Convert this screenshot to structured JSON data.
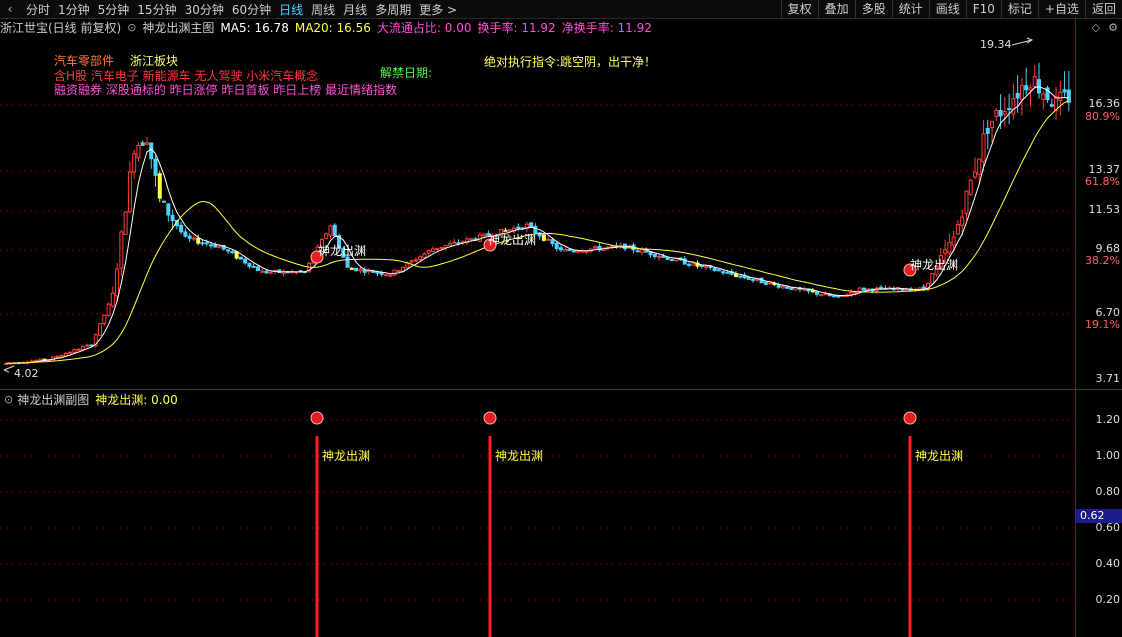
{
  "toolbar": {
    "periods": [
      "分时",
      "1分钟",
      "5分钟",
      "15分钟",
      "30分钟",
      "60分钟",
      "日线",
      "周线",
      "月线",
      "多周期",
      "更多 >"
    ],
    "active_period": "日线",
    "right_buttons": [
      "复权",
      "叠加",
      "多股",
      "统计",
      "画线",
      "F10",
      "标记",
      "+自选",
      "返回"
    ]
  },
  "info": {
    "stock": "浙江世宝(日线 前复权)",
    "indicator": "神龙出渊主图",
    "ma5": "MA5: 16.78",
    "ma20": "MA20: 16.56",
    "flow": "大流通占比: 0.00",
    "turnover": "换手率: 11.92",
    "net_turnover": "净换手率: 11.92"
  },
  "labels": {
    "sector1": "汽车零部件",
    "sector2": "浙江板块",
    "concepts": "含H股 汽车电子 新能源车 无人驾驶 小米汽车概念",
    "tags": "融资融券 深股通标的 昨日涨停 昨日首板 昨日上榜 最近情绪指数",
    "unlock": "解禁日期:",
    "directive": "绝对执行指令:跳空阴，出干净！",
    "signal": "神龙出渊",
    "high_mark": "19.34",
    "low_mark": "4.02"
  },
  "price_axis": [
    {
      "price": "16.36",
      "pct": "80.9%"
    },
    {
      "price": "13.37",
      "pct": "61.8%"
    },
    {
      "price": "11.53",
      "pct": ""
    },
    {
      "price": "9.68",
      "pct": "38.2%"
    },
    {
      "price": "6.70",
      "pct": "19.1%"
    },
    {
      "price": "3.71",
      "pct": ""
    }
  ],
  "sub": {
    "title": "神龙出渊副图",
    "value_label": "神龙出渊: 0.00",
    "axis": [
      "1.20",
      "1.00",
      "0.80",
      "0.60",
      "0.40",
      "0.20"
    ],
    "current": "0.62",
    "signal_label": "神龙出渊"
  },
  "colors": {
    "up": "#ff3b3b",
    "down": "#4dd2ff",
    "ma_short": "#ffffff",
    "ma_long": "#ffff44",
    "signal_bar": "#ff2020",
    "grid": "#7a0000"
  },
  "chart_data": {
    "type": "candlestick",
    "ylim": [
      3.71,
      19.34
    ],
    "high": 19.34,
    "low": 4.02,
    "signals_at_bar": [
      75,
      115,
      215
    ]
  }
}
